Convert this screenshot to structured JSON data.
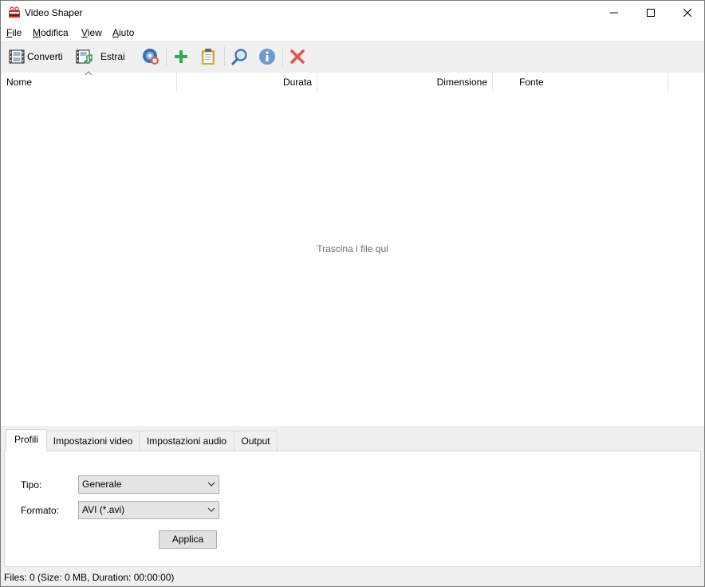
{
  "window": {
    "title": "Video Shaper"
  },
  "menu": [
    {
      "key": "F",
      "rest": "ile"
    },
    {
      "key": "M",
      "rest": "odifica"
    },
    {
      "key": "V",
      "rest": "iew"
    },
    {
      "key": "A",
      "rest": "iuto"
    }
  ],
  "toolbar": {
    "convert_label": "Converti",
    "extract_label": "Estrai",
    "icons": [
      "film-icon",
      "film-music-icon",
      "disc-record-icon",
      "plus-icon",
      "clipboard-icon",
      "magnifier-icon",
      "info-icon",
      "delete-icon"
    ]
  },
  "list": {
    "columns": [
      "Nome",
      "Durata",
      "Dimensione",
      "Fonte"
    ],
    "empty_hint": "Trascina i file qui"
  },
  "tabs": [
    "Profili",
    "Impostazioni video",
    "Impostazioni audio",
    "Output"
  ],
  "profile": {
    "type_label": "Tipo:",
    "type_value": "Generale",
    "format_label": "Formato:",
    "format_value": "AVI (*.avi)",
    "apply_label": "Applica"
  },
  "status": {
    "text": "Files: 0 (Size: 0 MB, Duration: 00:00:00)"
  },
  "colors": {
    "accent_green": "#3aa757",
    "delete_red": "#e0564f",
    "info_blue": "#6b9bd1",
    "clipboard_gold": "#d8a93a"
  }
}
